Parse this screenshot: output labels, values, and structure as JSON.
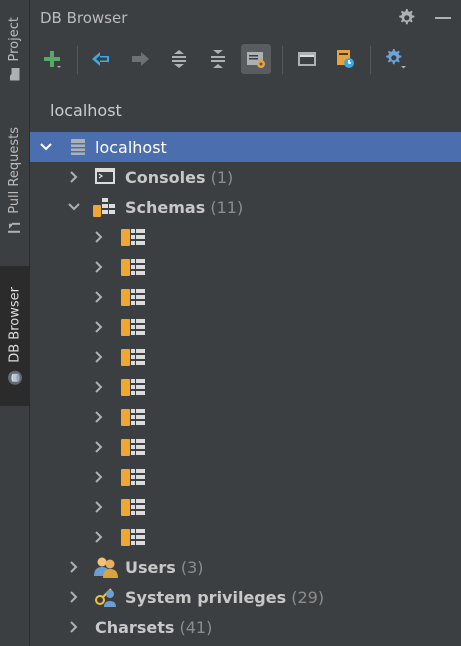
{
  "side_tabs": [
    {
      "label": "Project",
      "icon": "folder-icon"
    },
    {
      "label": "Pull Requests",
      "icon": "pull-request-icon"
    },
    {
      "label": "DB Browser",
      "icon": "db-browser-icon"
    }
  ],
  "panel": {
    "title": "DB Browser",
    "header_icons": [
      "gear-icon",
      "minimize-icon"
    ]
  },
  "toolbar": {
    "buttons": [
      "add-icon",
      "back-icon",
      "forward-icon",
      "expand-all-icon",
      "collapse-all-icon",
      "filter-icon",
      "console-icon",
      "schedule-icon",
      "settings-icon"
    ]
  },
  "connection_selector": {
    "label": "localhost"
  },
  "tree": {
    "root": {
      "label": "localhost",
      "icon": "database-icon",
      "expanded": true
    },
    "consoles": {
      "label": "Consoles",
      "count": "(1)",
      "icon": "console-icon"
    },
    "schemas": {
      "label": "Schemas",
      "count": "(11)",
      "icon": "schemas-icon",
      "expanded": true,
      "children": 11
    },
    "users": {
      "label": "Users",
      "count": "(3)",
      "icon": "users-icon"
    },
    "system_privileges": {
      "label": "System privileges",
      "count": "(29)",
      "icon": "privileges-icon"
    },
    "charsets": {
      "label": "Charsets",
      "count": "(41)"
    }
  },
  "colors": {
    "background": "#3c3f41",
    "selection": "#4b6eaf",
    "text": "#bbbbbb",
    "count_text": "#8c8c8c",
    "schema_orange": "#f0a732",
    "add_green": "#59a869",
    "nav_blue": "#40a8e0"
  }
}
